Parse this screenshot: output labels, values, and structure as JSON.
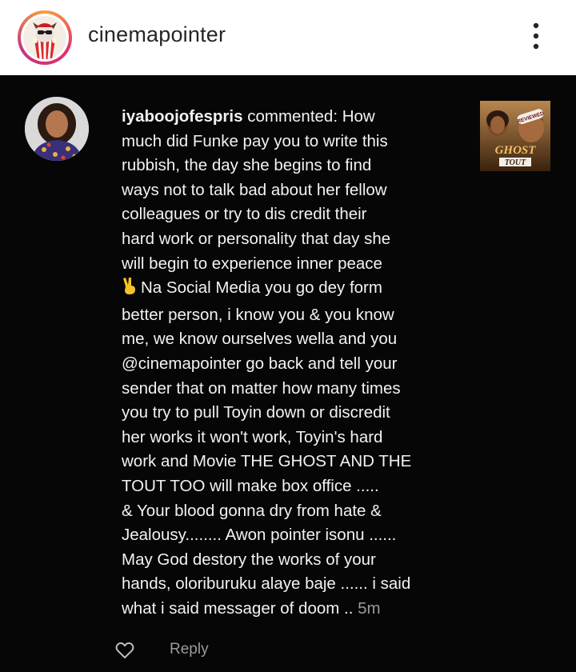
{
  "header": {
    "account_name": "cinemapointer",
    "more_icon": "more-vertical-icon"
  },
  "comment": {
    "username": "iyaboojofespris",
    "lines": [
      " commented: How",
      "much did Funke pay you to write this",
      "rubbish, the day she begins to find",
      "ways not to talk bad about her fellow",
      "colleagues or try to dis credit their",
      "hard work or personality that day she",
      "will begin to experience inner peace",
      "Na Social Media you go dey form",
      "better person, i know you & you know",
      "me, we know ourselves wella  and you",
      "@cinemapointer go back and tell your",
      "sender that on matter how many times",
      "you try to pull Toyin down or discredit",
      "her works it won't work, Toyin's hard",
      "work and Movie THE GHOST AND THE",
      "TOUT TOO will make box office .....",
      "& Your blood gonna dry from hate &",
      "Jealousy........ Awon pointer isonu ......",
      "May God destory the works of your",
      "hands, oloriburuku alaye baje ...... i said",
      "what i said messager of doom .. "
    ],
    "emoji": "victory-hand-icon",
    "timestamp": "5m"
  },
  "post_thumbnail": {
    "badge": "REVIEWED",
    "title_line1": "GHOST",
    "title_line2": "TOUT"
  },
  "actions": {
    "like_icon": "heart-icon",
    "reply_label": "Reply"
  },
  "colors": {
    "panel_bg": "#060606",
    "comment_text": "#f2f2f2",
    "muted_text": "#9a9a9a",
    "header_text": "#262626"
  }
}
